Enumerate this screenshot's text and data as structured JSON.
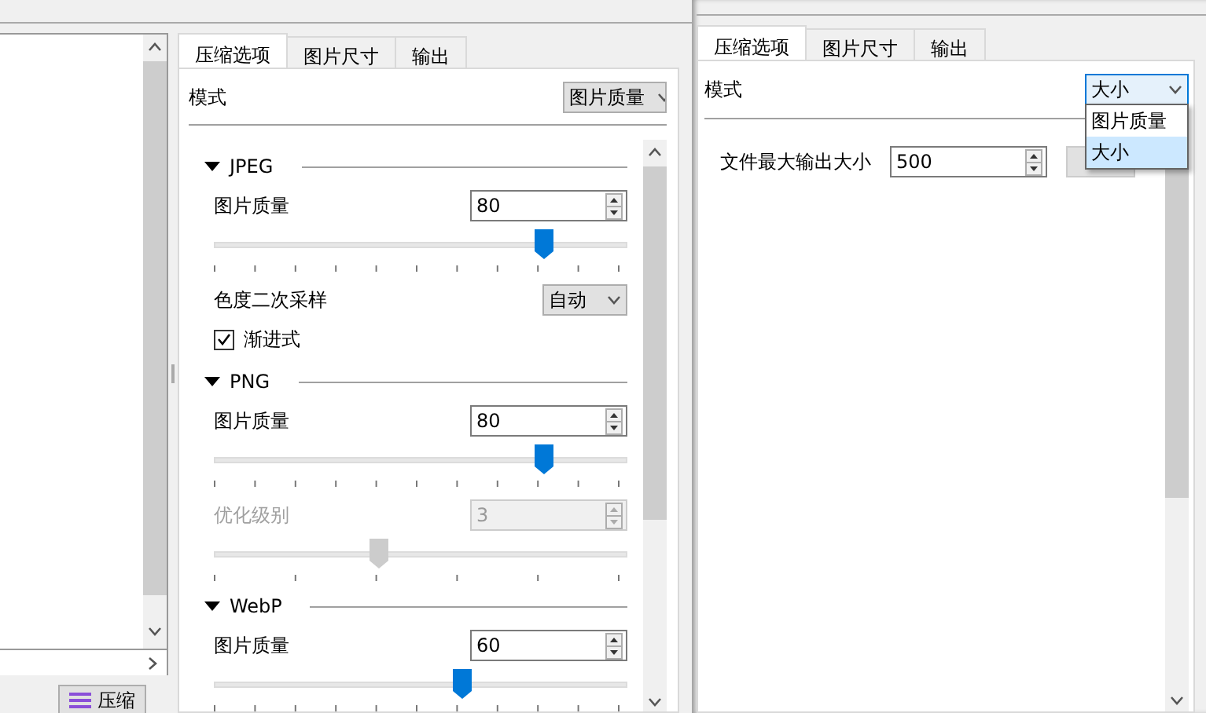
{
  "left_window": {
    "compress_button": {
      "label": "压缩"
    },
    "tabs": [
      {
        "label": "压缩选项",
        "selected": true
      },
      {
        "label": "图片尺寸",
        "selected": false
      },
      {
        "label": "输出",
        "selected": false
      }
    ],
    "mode": {
      "label": "模式",
      "value": "图片质量"
    },
    "sections": [
      {
        "title": "JPEG",
        "expanded": true,
        "rows": [
          {
            "kind": "spin",
            "label": "图片质量",
            "value": "80",
            "disabled": false
          },
          {
            "kind": "slider",
            "level": 0.8,
            "disabled": false
          },
          {
            "kind": "combo",
            "label": "色度二次采样",
            "value": "自动"
          },
          {
            "kind": "checkbox",
            "label": "渐进式",
            "checked": true
          }
        ]
      },
      {
        "title": "PNG",
        "expanded": true,
        "rows": [
          {
            "kind": "spin",
            "label": "图片质量",
            "value": "80",
            "disabled": false
          },
          {
            "kind": "slider",
            "level": 0.8,
            "disabled": false
          },
          {
            "kind": "spin",
            "label": "优化级别",
            "value": "3",
            "disabled": true
          },
          {
            "kind": "stepslider",
            "level": 0.4,
            "disabled": true
          }
        ]
      },
      {
        "title": "WebP",
        "expanded": true,
        "rows": [
          {
            "kind": "spin",
            "label": "图片质量",
            "value": "60",
            "disabled": false
          },
          {
            "kind": "slider",
            "level": 0.6,
            "disabled": false
          }
        ]
      }
    ]
  },
  "right_window": {
    "tabs": [
      {
        "label": "压缩选项",
        "selected": true
      },
      {
        "label": "图片尺寸",
        "selected": false
      },
      {
        "label": "输出",
        "selected": false
      }
    ],
    "mode": {
      "label": "模式",
      "value": "大小",
      "open": true,
      "options": [
        {
          "label": "图片质量",
          "selected": false
        },
        {
          "label": "大小",
          "selected": true
        }
      ]
    },
    "max_size": {
      "label": "文件最大输出大小",
      "value": "500"
    }
  }
}
